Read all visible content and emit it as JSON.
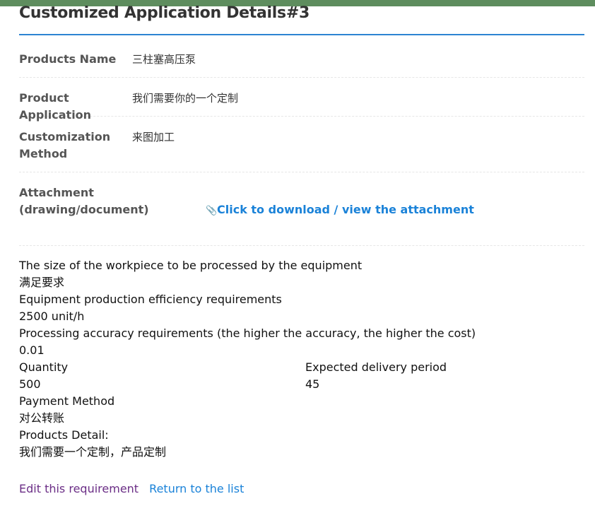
{
  "page": {
    "title": "Customized Application Details#3"
  },
  "details": {
    "products_name_label": "Products Name",
    "products_name_value": "三柱塞高压泵",
    "product_application_label": "Product Application",
    "product_application_value": "我们需要你的一个定制",
    "customization_method_label_1": "Customization",
    "customization_method_label_2": "Method",
    "customization_method_value": "来图加工",
    "attachment_label_1": "Attachment",
    "attachment_label_2": "(drawing/document)",
    "attachment_link": "Click to download / view the attachment"
  },
  "specs": {
    "workpiece_size_label": "The size of the workpiece to be processed by the equipment",
    "workpiece_size_value": "满足要求",
    "efficiency_label": "Equipment production efficiency requirements",
    "efficiency_value": "2500 unit/h",
    "accuracy_label": "Processing accuracy requirements (the higher the accuracy, the higher the cost)",
    "accuracy_value": "0.01",
    "quantity_label": "Quantity",
    "quantity_value": "500",
    "delivery_label": "Expected delivery period",
    "delivery_value": "45",
    "payment_label": "Payment Method",
    "payment_value": "对公转账",
    "detail_label": "Products Detail:",
    "detail_value": "我们需要一个定制，产品定制"
  },
  "actions": {
    "edit": "Edit this requirement",
    "back": "Return to the list"
  },
  "icons": {
    "attachment": "paperclip-icon"
  },
  "colors": {
    "accent": "#2d84d2",
    "link": "#1a82d8",
    "visited_link": "#6b2e86",
    "top_strip": "#5e8d5e"
  }
}
